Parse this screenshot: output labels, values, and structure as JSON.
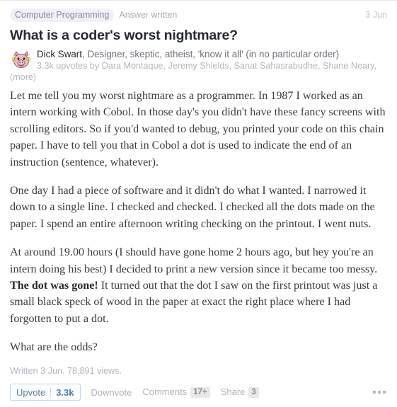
{
  "header": {
    "topic": "Computer Programming",
    "status": "Answer written",
    "date": "3 Jun"
  },
  "question": {
    "title": "What is a coder's worst nightmare?"
  },
  "author": {
    "avatar_icon": "pig-avatar-icon",
    "name": "Dick Swart",
    "credential": ", Designer, skeptic, atheist, 'know it all' (in no particular order)",
    "upvotes_text": "3.3k upvotes by ",
    "upvoters": "Dara Montaque, Jeremy Shields, Sanat Sahasrabudhe, Shane Neary",
    "upvoters_separator": ", ",
    "more_label": "(more)"
  },
  "body": {
    "paragraphs": [
      "Let me tell you my worst nightmare as a programmer. In 1987 I worked as an intern working with Cobol. In those day's you didn't have these fancy screens with scrolling editors. So if you'd wanted to debug, you printed your code on this chain paper. I have to tell you that in Cobol a dot is used to indicate the end of an instruction (sentence, whatever).",
      "One day I had a piece of software and it didn't do what I wanted. I narrowed it down to a single line. I checked and checked. I checked all the dots made on the paper. I spend an entire afternoon writing checking on the printout. I went nuts.",
      "What are the odds?"
    ],
    "para3_part1": "At around 19.00 hours (I should have gone home 2 hours ago, but hey you're an intern doing his best) I decided to print a new version since it became too messy. ",
    "para3_bold": "The dot was gone!",
    "para3_part2": " It turned out that the dot I saw on the first printout was just a small black speck of wood in the paper at exact the right place where I had forgotten to put a dot."
  },
  "footer": {
    "written_line": "Written 3 Jun. 78,891 views."
  },
  "actions": {
    "upvote_label": "Upvote",
    "upvote_count": "3.3k",
    "downvote_label": "Downvote",
    "comments_label": "Comments",
    "comments_count": "17+",
    "share_label": "Share",
    "share_count": "3",
    "overflow_icon": "ellipsis-icon"
  },
  "colors": {
    "accent_blue": "#4c7eb8",
    "badge_bg": "#f0effa",
    "muted_text": "#b4b6bf",
    "title_text": "#262a33"
  }
}
